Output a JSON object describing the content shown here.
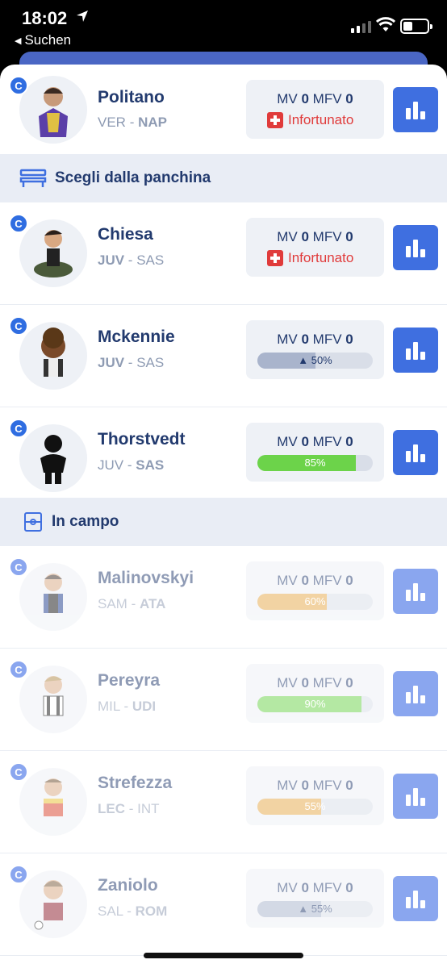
{
  "status": {
    "time": "18:02",
    "back_label": "Suchen"
  },
  "players_top": [
    {
      "name": "Politano",
      "home": "VER",
      "away": "NAP",
      "bold": "away",
      "mv": "0",
      "mfv": "0",
      "status": "injured",
      "status_label": "Infortunato"
    }
  ],
  "section_bench": {
    "title": "Scegli dalla panchina"
  },
  "bench": [
    {
      "name": "Chiesa",
      "home": "JUV",
      "away": "SAS",
      "bold": "home",
      "mv": "0",
      "mfv": "0",
      "status": "injured",
      "status_label": "Infortunato"
    },
    {
      "name": "Mckennie",
      "home": "JUV",
      "away": "SAS",
      "bold": "home",
      "mv": "0",
      "mfv": "0",
      "status": "bar",
      "percent": 50,
      "percent_label": "50%",
      "bar_color": "#a9b4cc",
      "arrow": true
    },
    {
      "name": "Thorstvedt",
      "home": "JUV",
      "away": "SAS",
      "bold": "away",
      "mv": "0",
      "mfv": "0",
      "status": "bar",
      "percent": 85,
      "percent_label": "85%",
      "bar_color": "#6cd34a"
    }
  ],
  "section_field": {
    "title": "In campo"
  },
  "field": [
    {
      "name": "Malinovskyi",
      "home": "SAM",
      "away": "ATA",
      "bold": "away",
      "mv": "0",
      "mfv": "0",
      "percent": 60,
      "percent_label": "60%",
      "bar_color": "#e7a94a"
    },
    {
      "name": "Pereyra",
      "home": "MIL",
      "away": "UDI",
      "bold": "away",
      "mv": "0",
      "mfv": "0",
      "percent": 90,
      "percent_label": "90%",
      "bar_color": "#6cd34a"
    },
    {
      "name": "Strefezza",
      "home": "LEC",
      "away": "INT",
      "bold": "home",
      "mv": "0",
      "mfv": "0",
      "percent": 55,
      "percent_label": "55%",
      "bar_color": "#e7a94a"
    },
    {
      "name": "Zaniolo",
      "home": "SAL",
      "away": "ROM",
      "bold": "away",
      "mv": "0",
      "mfv": "0",
      "percent": 55,
      "percent_label": "55%",
      "bar_color": "#a9b4cc",
      "arrow": true
    }
  ],
  "labels": {
    "mv": "MV",
    "mfv": "MFV",
    "badge": "C"
  },
  "colors": {
    "accent": "#3f6fe0",
    "title": "#223a6e",
    "injured": "#e03b3b"
  }
}
